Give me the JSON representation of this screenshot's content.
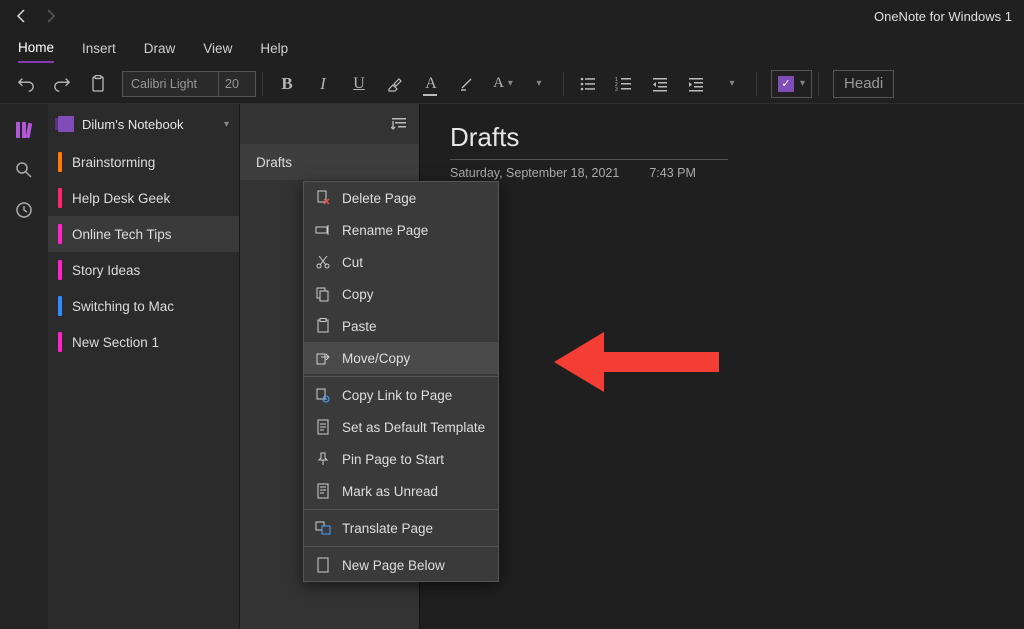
{
  "app_title": "OneNote for Windows 1",
  "ribbon": {
    "tabs": [
      "Home",
      "Insert",
      "Draw",
      "View",
      "Help"
    ],
    "active_tab": 0
  },
  "toolbar": {
    "font_name": "Calibri Light",
    "font_size": "20",
    "heading_label": "Headi"
  },
  "notebook": {
    "name": "Dilum's Notebook"
  },
  "sections": [
    {
      "label": "Brainstorming",
      "color": "#ff7c00"
    },
    {
      "label": "Help Desk Geek",
      "color": "#ff2370"
    },
    {
      "label": "Online Tech Tips",
      "color": "#ff25c4",
      "active": true
    },
    {
      "label": "Story Ideas",
      "color": "#ff25c4"
    },
    {
      "label": "Switching to Mac",
      "color": "#2f8cff"
    },
    {
      "label": "New Section 1",
      "color": "#ff25c4"
    }
  ],
  "pages": [
    {
      "label": "Drafts",
      "active": true
    }
  ],
  "page": {
    "title": "Drafts",
    "date": "Saturday, September 18, 2021",
    "time": "7:43 PM"
  },
  "context_menu": {
    "items": [
      {
        "icon": "delete-page-icon",
        "label": "Delete Page"
      },
      {
        "icon": "rename-icon",
        "label": "Rename Page"
      },
      {
        "icon": "cut-icon",
        "label": "Cut"
      },
      {
        "icon": "copy-icon",
        "label": "Copy"
      },
      {
        "icon": "paste-icon",
        "label": "Paste"
      },
      {
        "icon": "move-copy-icon",
        "label": "Move/Copy",
        "hover": true
      },
      {
        "separator": true
      },
      {
        "icon": "copy-link-icon",
        "label": "Copy Link to Page"
      },
      {
        "icon": "template-icon",
        "label": "Set as Default Template"
      },
      {
        "icon": "pin-icon",
        "label": "Pin Page to Start"
      },
      {
        "icon": "mark-unread-icon",
        "label": "Mark as Unread"
      },
      {
        "separator": true
      },
      {
        "icon": "translate-icon",
        "label": "Translate Page"
      },
      {
        "separator": true
      },
      {
        "icon": "new-page-icon",
        "label": "New Page Below"
      }
    ]
  }
}
